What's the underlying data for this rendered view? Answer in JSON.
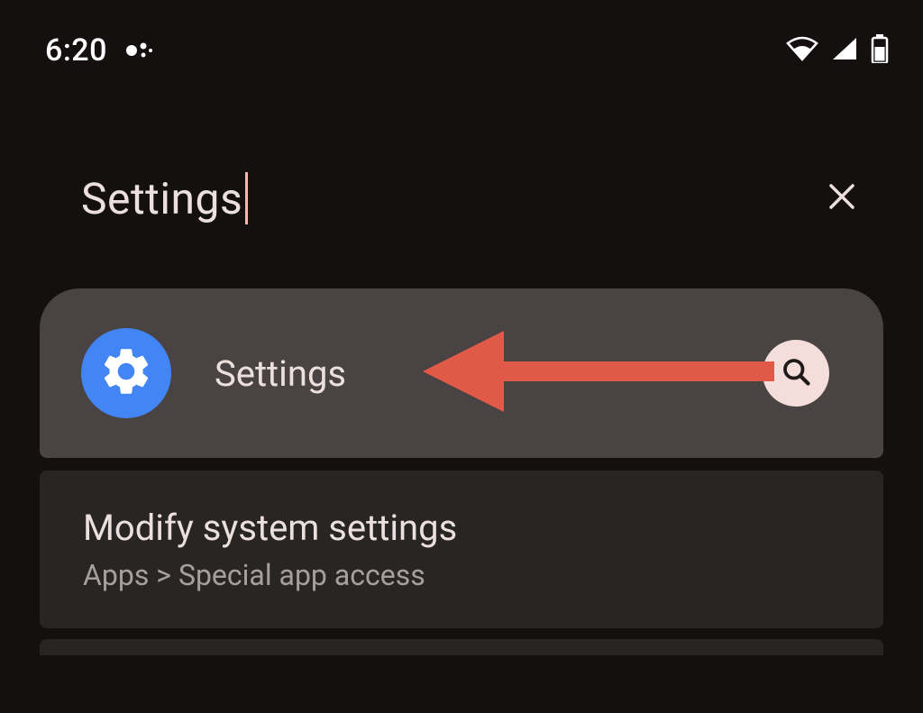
{
  "status_bar": {
    "time": "6:20"
  },
  "search": {
    "query": "Settings"
  },
  "results": {
    "primary": {
      "title": "Settings",
      "icon_name": "gear-icon"
    },
    "secondary": {
      "title": "Modify system settings",
      "breadcrumb": "Apps > Special app access"
    }
  },
  "annotation": {
    "arrow_color": "#e05a47"
  }
}
